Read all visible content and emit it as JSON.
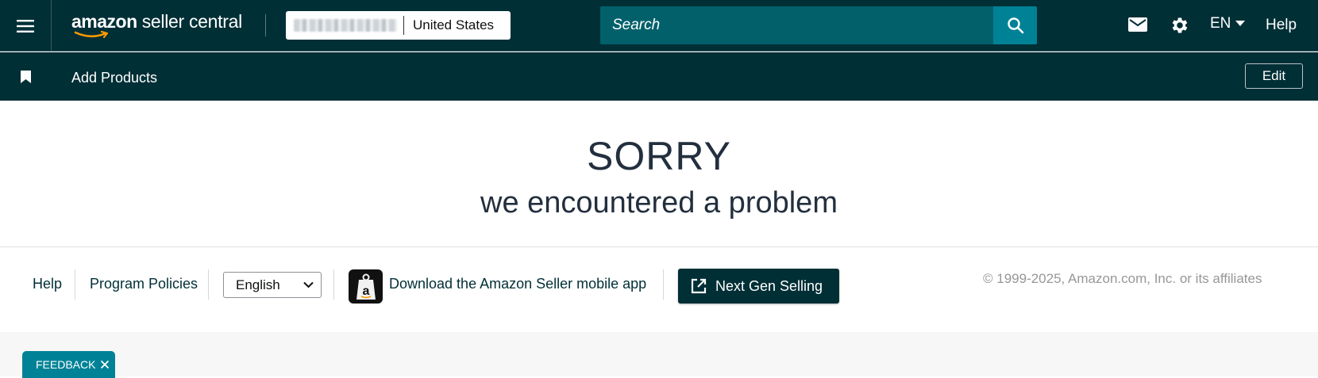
{
  "colors": {
    "header_bg": "#002f36",
    "search_field": "#02606b",
    "search_button": "#008296",
    "accent_teal": "#008296",
    "text_dark": "#232f3e"
  },
  "header": {
    "logo_bold": "amazon",
    "logo_rest": " seller central",
    "account_country": "United States",
    "search_placeholder": "Search",
    "language": "EN",
    "help": "Help",
    "icons": [
      "menu-icon",
      "search-icon",
      "mail-icon",
      "gear-icon",
      "caret-down-icon"
    ]
  },
  "subnav": {
    "bookmark_label": "Add Products",
    "edit_label": "Edit",
    "icon": "bookmark-icon"
  },
  "error": {
    "title": "SORRY",
    "subtitle": "we encountered a problem"
  },
  "footer": {
    "help": "Help",
    "program_policies": "Program Policies",
    "language_selected": "English",
    "app_download": "Download the Amazon Seller mobile app",
    "next_gen_button": "Next Gen Selling",
    "copyright": "© 1999-2025, Amazon.com, Inc. or its affiliates"
  },
  "feedback": {
    "label": "FEEDBACK"
  }
}
